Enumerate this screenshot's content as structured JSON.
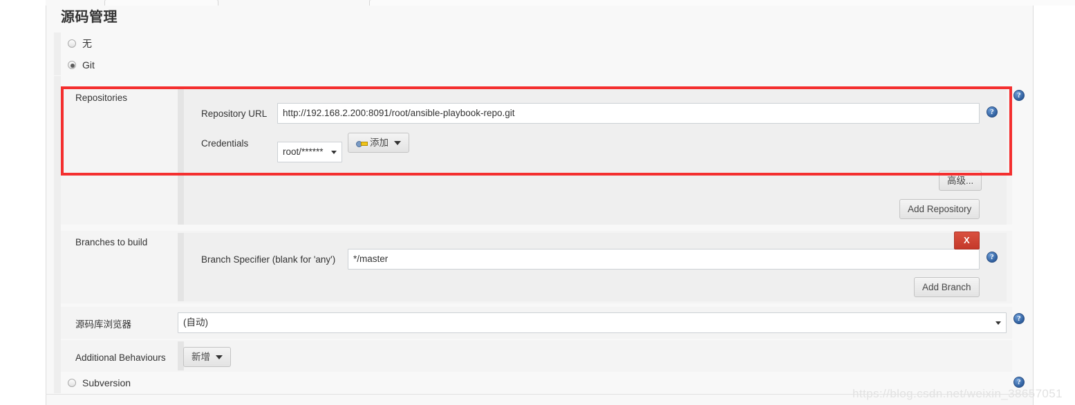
{
  "page": {
    "title": "源码管理",
    "watermark": "https://blog.csdn.net/weixin_38657051"
  },
  "scm_options": [
    {
      "label": "无",
      "checked": false
    },
    {
      "label": "Git",
      "checked": true
    },
    {
      "label": "Subversion",
      "checked": false
    }
  ],
  "repositories": {
    "section_label": "Repositories",
    "repository_url": {
      "label": "Repository URL",
      "value": "http://192.168.2.200:8091/root/ansible-playbook-repo.git"
    },
    "credentials": {
      "label": "Credentials",
      "selected": "root/******",
      "add_button": "添加"
    },
    "advanced_button": "高级...",
    "add_repository_button": "Add Repository"
  },
  "branches": {
    "section_label": "Branches to build",
    "branch_specifier": {
      "label": "Branch Specifier (blank for 'any')",
      "value": "*/master"
    },
    "delete_button": "X",
    "add_branch_button": "Add Branch"
  },
  "repository_browser": {
    "label": "源码库浏览器",
    "selected": "(自动)"
  },
  "additional_behaviours": {
    "label": "Additional Behaviours",
    "add_button": "新增"
  },
  "icons": {
    "help": "?",
    "key": "key-icon"
  },
  "colors": {
    "highlight": "#f42f2f",
    "danger": "#c4392a",
    "help": "#2f5f9e",
    "panel_bg": "#efefef",
    "page_bg": "#f8f8f8"
  }
}
